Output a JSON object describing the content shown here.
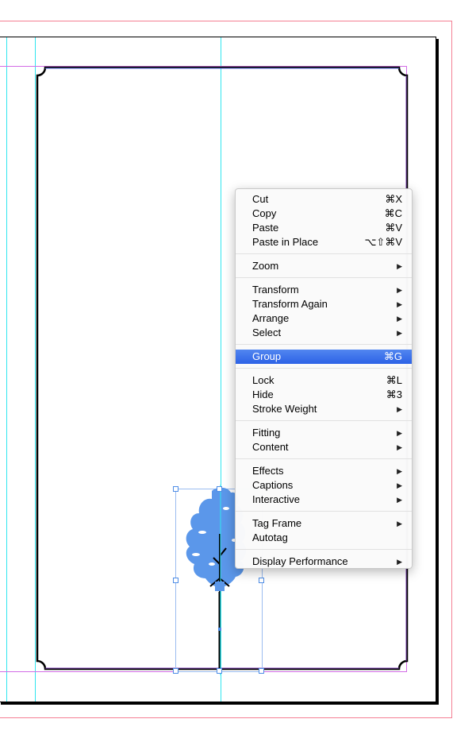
{
  "canvas": {
    "colors": {
      "bleed": "#f47f93",
      "guide": "#30e6ef",
      "margin": "#d36ce6",
      "selection": "#4e8de6",
      "tree_fill": "#5b97ea",
      "menu_highlight": "#3f6fe8"
    },
    "objects": [
      {
        "name": "decorative-frame",
        "type": "rounded-corner frame"
      },
      {
        "name": "tree-graphic",
        "type": "selected image group",
        "fill": "#5b97ea"
      }
    ]
  },
  "context_menu": {
    "groups": [
      {
        "items": [
          {
            "label": "Cut",
            "shortcut": "⌘X",
            "submenu": false
          },
          {
            "label": "Copy",
            "shortcut": "⌘C",
            "submenu": false
          },
          {
            "label": "Paste",
            "shortcut": "⌘V",
            "submenu": false
          },
          {
            "label": "Paste in Place",
            "shortcut": "⌥⇧⌘V",
            "submenu": false
          }
        ]
      },
      {
        "items": [
          {
            "label": "Zoom",
            "shortcut": "",
            "submenu": true
          }
        ]
      },
      {
        "items": [
          {
            "label": "Transform",
            "shortcut": "",
            "submenu": true
          },
          {
            "label": "Transform Again",
            "shortcut": "",
            "submenu": true
          },
          {
            "label": "Arrange",
            "shortcut": "",
            "submenu": true
          },
          {
            "label": "Select",
            "shortcut": "",
            "submenu": true
          }
        ]
      },
      {
        "items": [
          {
            "label": "Group",
            "shortcut": "⌘G",
            "submenu": false,
            "highlighted": true
          }
        ]
      },
      {
        "items": [
          {
            "label": "Lock",
            "shortcut": "⌘L",
            "submenu": false
          },
          {
            "label": "Hide",
            "shortcut": "⌘3",
            "submenu": false
          },
          {
            "label": "Stroke Weight",
            "shortcut": "",
            "submenu": true
          }
        ]
      },
      {
        "items": [
          {
            "label": "Fitting",
            "shortcut": "",
            "submenu": true
          },
          {
            "label": "Content",
            "shortcut": "",
            "submenu": true
          }
        ]
      },
      {
        "items": [
          {
            "label": "Effects",
            "shortcut": "",
            "submenu": true
          },
          {
            "label": "Captions",
            "shortcut": "",
            "submenu": true
          },
          {
            "label": "Interactive",
            "shortcut": "",
            "submenu": true
          }
        ]
      },
      {
        "items": [
          {
            "label": "Tag Frame",
            "shortcut": "",
            "submenu": true
          },
          {
            "label": "Autotag",
            "shortcut": "",
            "submenu": false
          }
        ]
      },
      {
        "items": [
          {
            "label": "Display Performance",
            "shortcut": "",
            "submenu": true
          }
        ]
      }
    ],
    "submenu_arrow": "▶"
  }
}
